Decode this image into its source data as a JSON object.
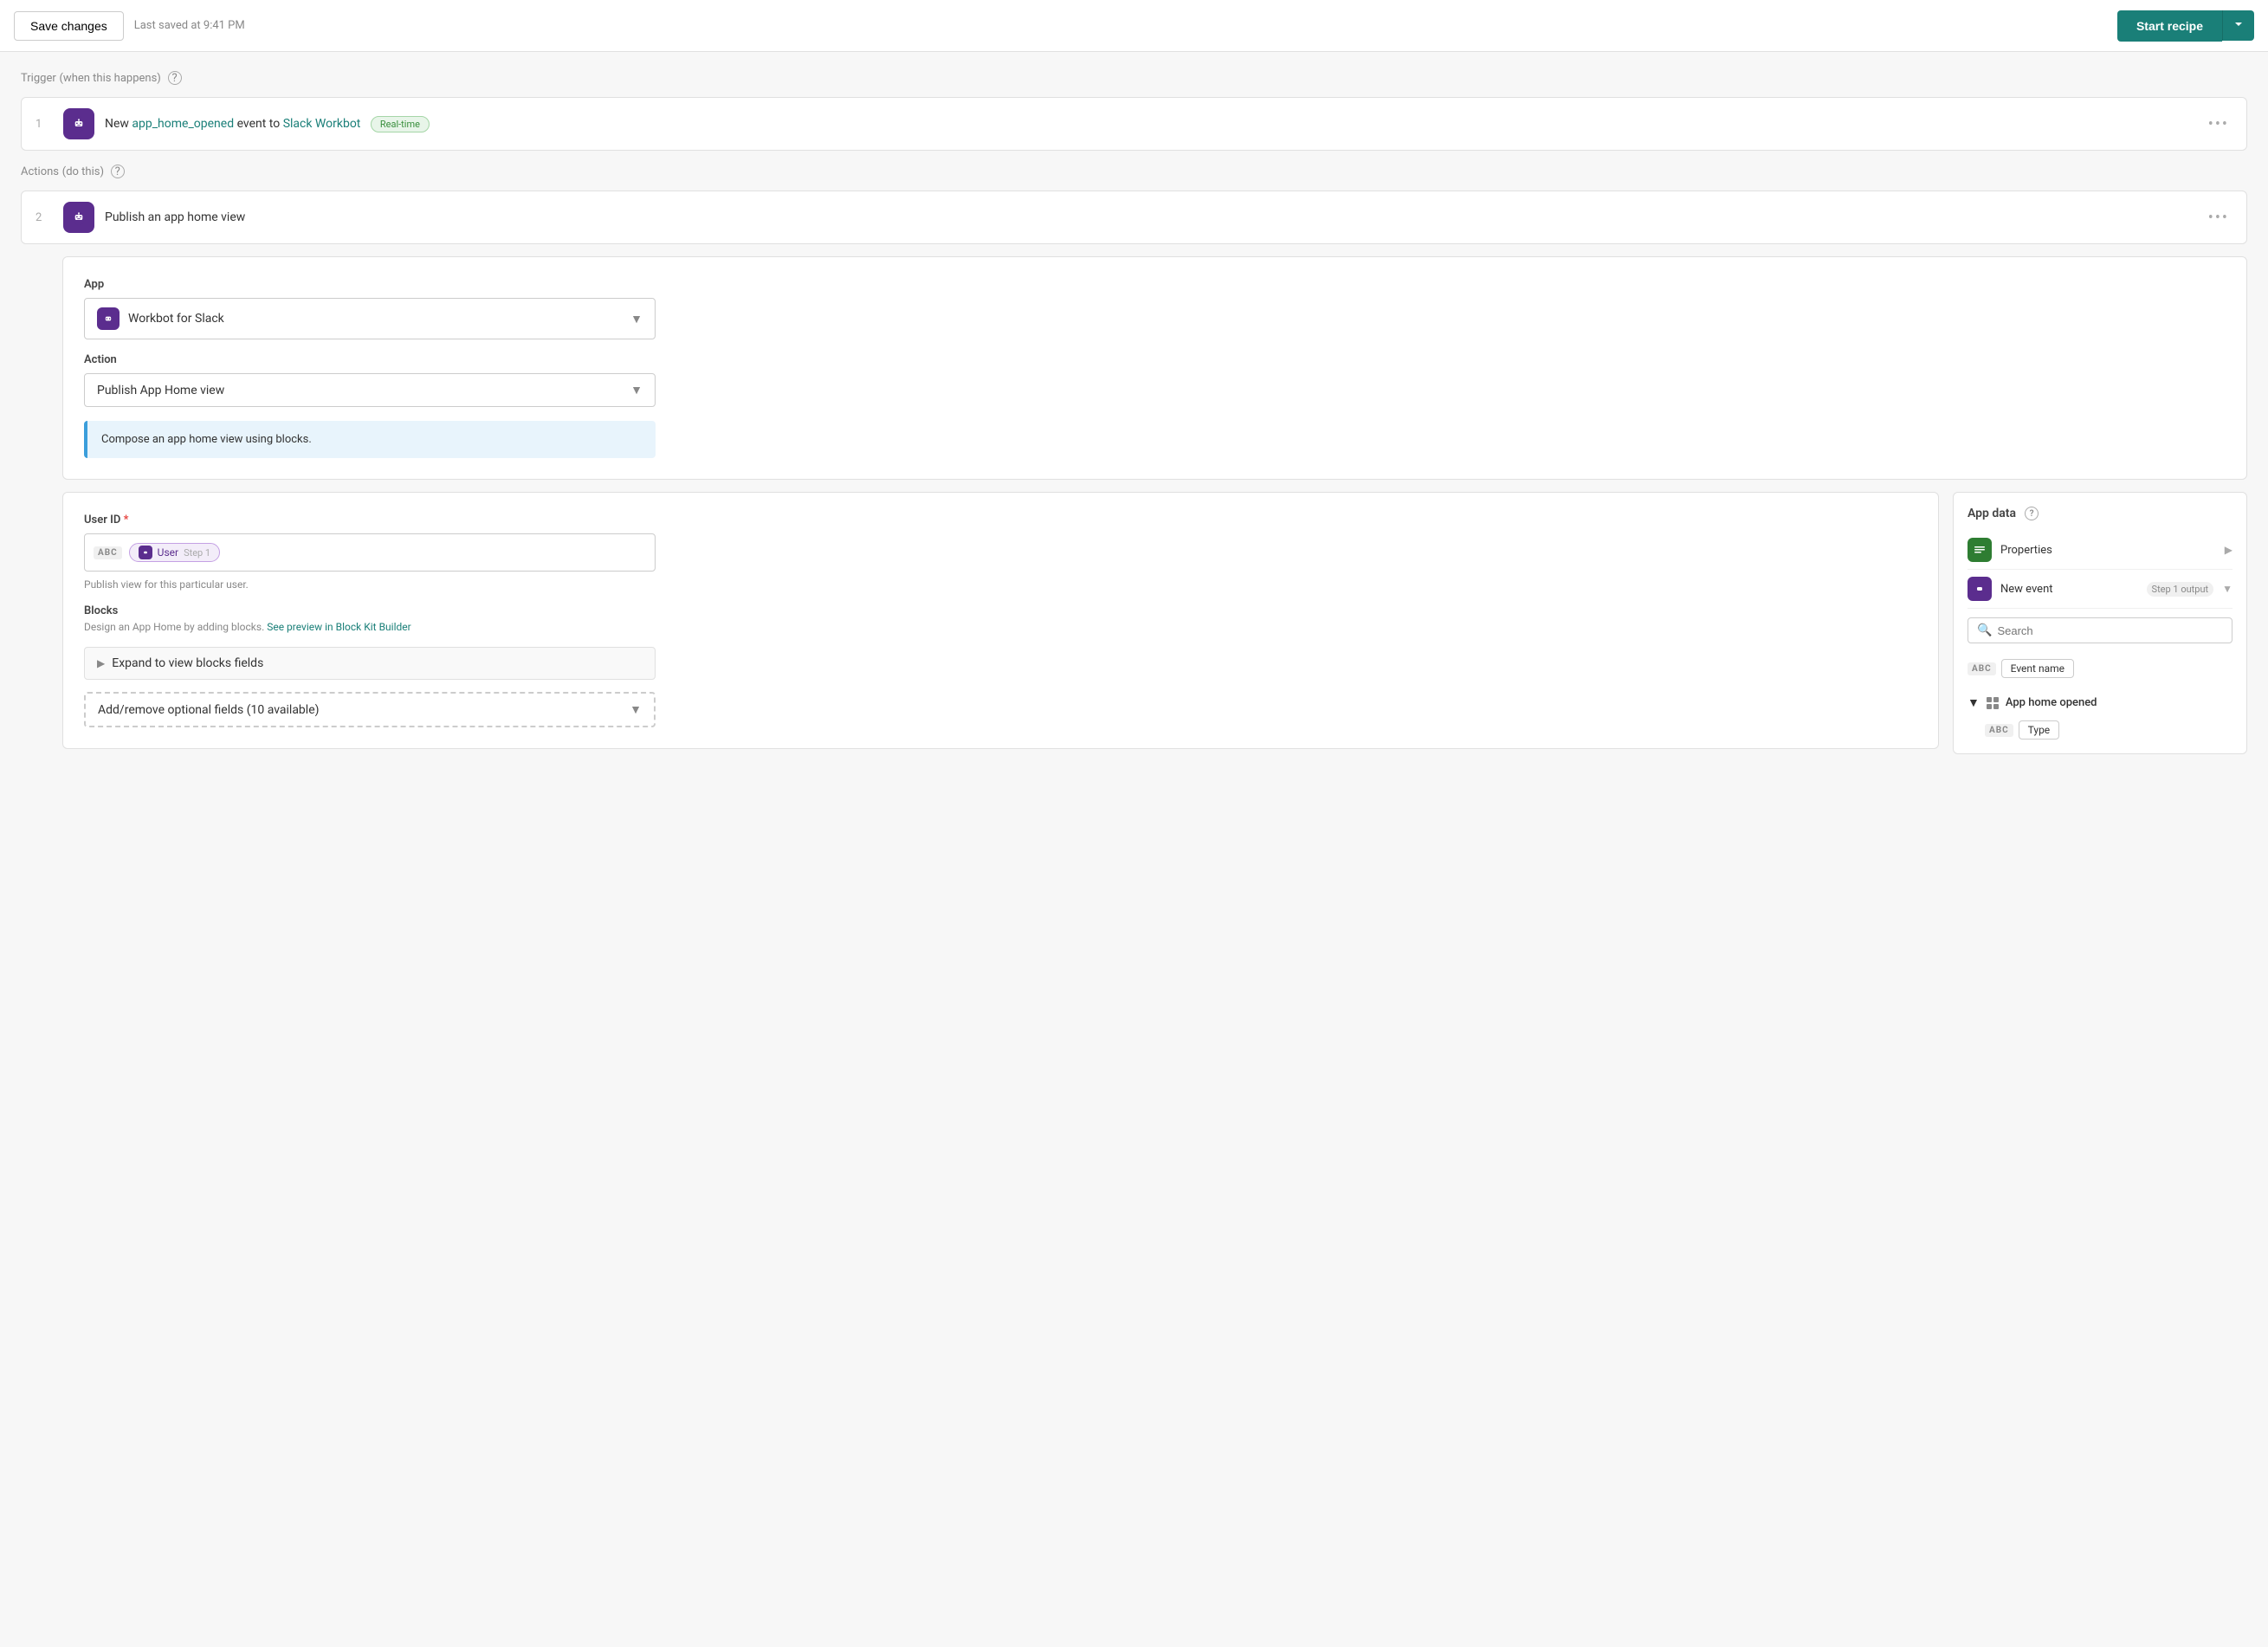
{
  "header": {
    "save_label": "Save changes",
    "last_saved": "Last saved at 9:41 PM",
    "start_recipe_label": "Start recipe"
  },
  "trigger": {
    "label": "Trigger",
    "subtitle": "(when this happens)",
    "step_number": "1",
    "description_prefix": "New ",
    "event_link": "app_home_opened",
    "description_middle": " event to ",
    "app_link": "Slack Workbot",
    "badge": "Real-time"
  },
  "actions": {
    "label": "Actions",
    "subtitle": "(do this)",
    "step_number": "2",
    "description": "Publish an app home view"
  },
  "action_panel": {
    "app_label": "App",
    "app_value": "Workbot for Slack",
    "action_label": "Action",
    "action_value": "Publish App Home view",
    "info_text": "Compose an app home view using blocks."
  },
  "user_id": {
    "label": "User ID",
    "required": true,
    "token_label": "User",
    "token_step": "Step 1",
    "hint": "Publish view for this particular user."
  },
  "blocks": {
    "label": "Blocks",
    "hint_prefix": "Design an App Home by adding blocks. ",
    "hint_link": "See preview in Block Kit Builder",
    "expand_label": "Expand to view blocks fields",
    "optional_label": "Add/remove optional fields (10 available)"
  },
  "app_data": {
    "header": "App data",
    "properties_label": "Properties",
    "new_event_label": "New event",
    "new_event_badge": "Step 1 output",
    "search_placeholder": "Search",
    "event_name_label": "Event name",
    "app_home_label": "App home opened",
    "type_label": "Type"
  }
}
